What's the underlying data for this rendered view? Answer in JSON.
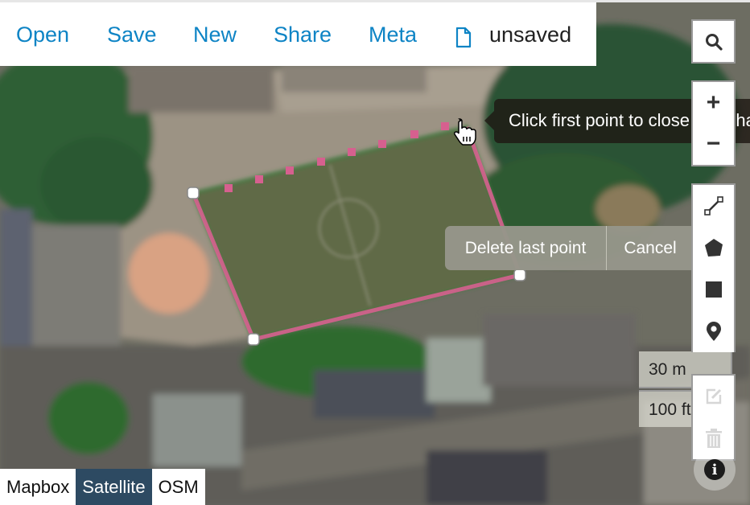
{
  "toolbar": {
    "links": [
      "Open",
      "Save",
      "New",
      "Share",
      "Meta"
    ],
    "file_icon": "file-icon",
    "filename": "unsaved"
  },
  "map_controls": {
    "search_icon": "search-icon",
    "zoom_in": "+",
    "zoom_out": "−",
    "draw_tools": [
      "line-icon",
      "polygon-icon",
      "rectangle-icon",
      "marker-icon"
    ],
    "edit_icon": "edit-icon",
    "delete_icon": "trash-icon",
    "info_icon": "i"
  },
  "drawing": {
    "tooltip": "Click first point to close this shape",
    "delete_last_point": "Delete last point",
    "cancel": "Cancel",
    "stroke_color": "#d6608f"
  },
  "scale": {
    "metric": "30 m",
    "imperial": "100 ft"
  },
  "layers": {
    "items": [
      "Mapbox",
      "Satellite",
      "OSM"
    ],
    "active": "Satellite"
  }
}
